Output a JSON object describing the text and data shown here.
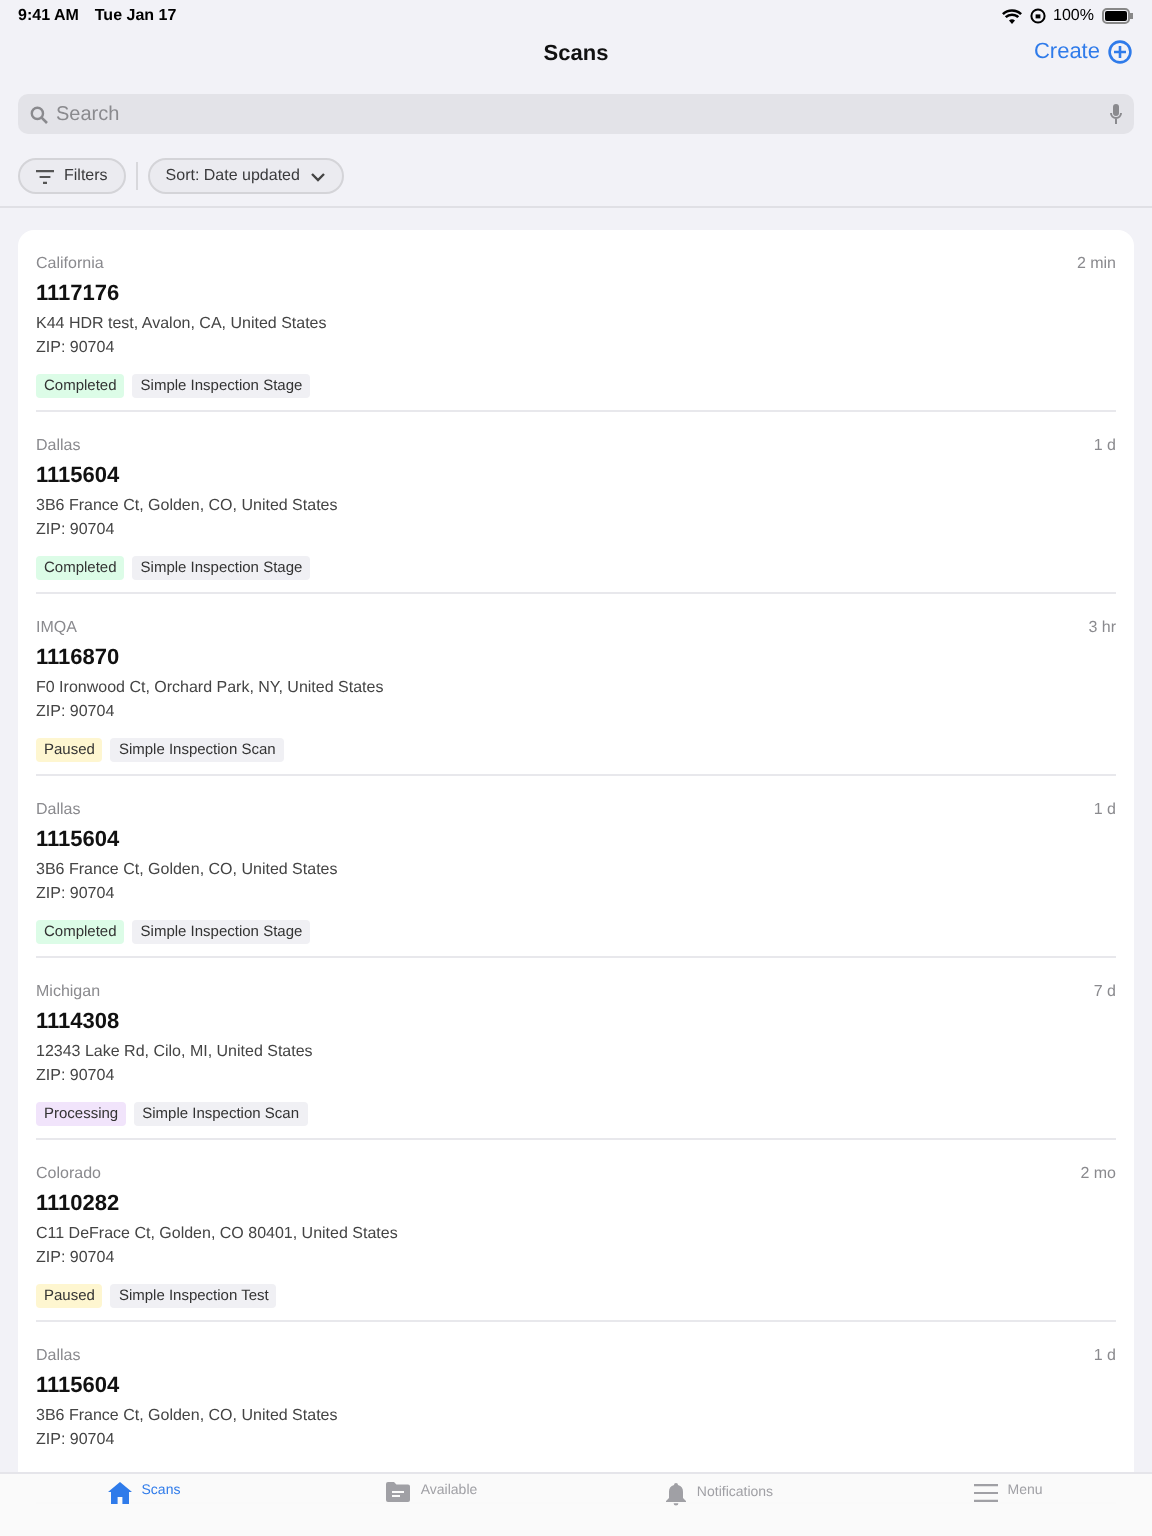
{
  "status_bar": {
    "time": "9:41 AM",
    "date": "Tue Jan 17",
    "battery": "100%"
  },
  "header": {
    "title": "Scans",
    "action": "Create"
  },
  "search": {
    "placeholder": "Search"
  },
  "filters": [
    {
      "kind": "filter",
      "label": "Filters"
    },
    {
      "kind": "sort",
      "label": "Sort: Date updated"
    }
  ],
  "scans": [
    {
      "region": "California",
      "time": "2 min",
      "id": "1117176",
      "address": "K44 HDR test, Avalon, CA, United States",
      "zip": "ZIP: 90704",
      "status": {
        "label": "Completed",
        "color": "#dcfce7"
      },
      "type": "Simple Inspection Stage"
    },
    {
      "region": "Dallas",
      "time": "1 d",
      "id": "1115604",
      "address": "3B6 France Ct, Golden, CO, United States",
      "zip": "ZIP: 90704",
      "status": {
        "label": "Completed",
        "color": "#dcfce7"
      },
      "type": "Simple Inspection Stage"
    },
    {
      "region": "IMQA",
      "time": "3 hr",
      "id": "1116870",
      "address": "F0 Ironwood Ct, Orchard Park, NY, United States",
      "zip": "ZIP: 90704",
      "status": {
        "label": "Paused",
        "color": "#fef6d0"
      },
      "type": "Simple Inspection Scan"
    },
    {
      "region": "Dallas",
      "time": "1 d",
      "id": "1115604",
      "address": "3B6 France Ct, Golden, CO, United States",
      "zip": "ZIP: 90704",
      "status": {
        "label": "Completed",
        "color": "#dcfce7"
      },
      "type": "Simple Inspection Stage"
    },
    {
      "region": "Michigan",
      "time": "7 d",
      "id": "1114308",
      "address": "12343 Lake Rd, Cilo, MI, United States",
      "zip": "ZIP: 90704",
      "status": {
        "label": "Processing",
        "color": "#f1e4fb"
      },
      "type": "Simple Inspection Scan"
    },
    {
      "region": "Colorado",
      "time": "2 mo",
      "id": "1110282",
      "address": "C11 DeFrace Ct, Golden, CO 80401, United States",
      "zip": "ZIP: 90704",
      "status": {
        "label": "Paused",
        "color": "#fef6d0"
      },
      "type": "Simple Inspection Test"
    },
    {
      "region": "Dallas",
      "time": "1 d",
      "id": "1115604",
      "address": "3B6 France Ct, Golden, CO, United States",
      "zip": "ZIP: 90704"
    }
  ],
  "tab_bar": [
    {
      "kind": "home",
      "label": "Scans",
      "selected": true
    },
    {
      "kind": "folder",
      "label": "Available",
      "selected": false
    },
    {
      "kind": "bell",
      "label": "Notifications",
      "selected": false
    },
    {
      "kind": "menu",
      "label": "Menu",
      "selected": false
    }
  ]
}
